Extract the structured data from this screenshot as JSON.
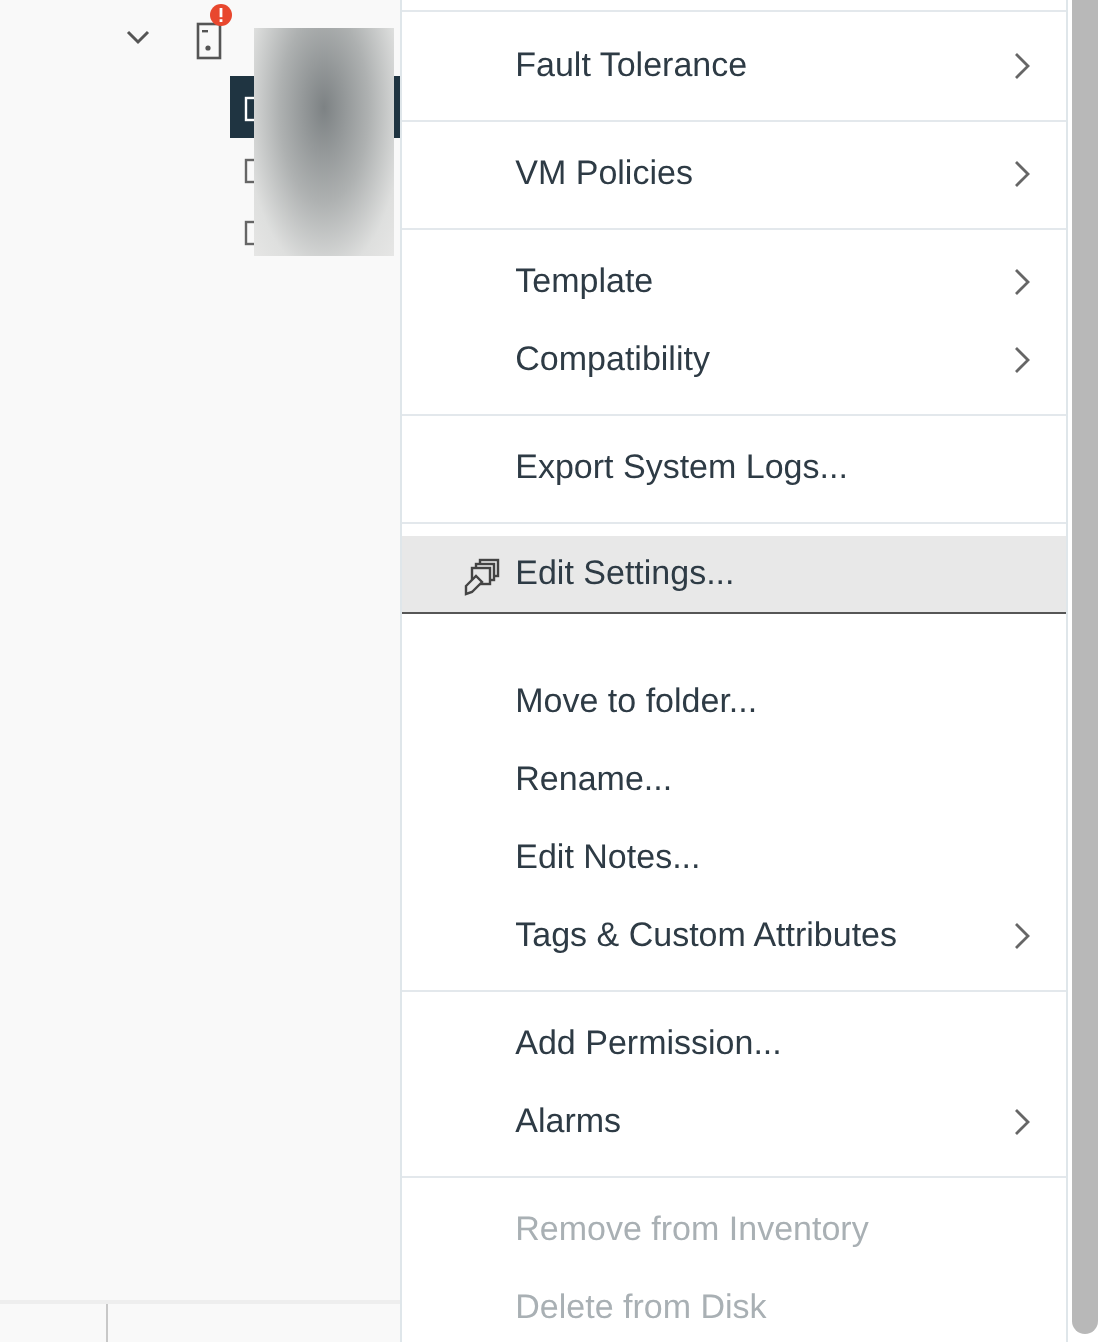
{
  "tree": {
    "host": {
      "expanded": true,
      "alert": true
    },
    "vms": [
      {
        "selected": true
      },
      {
        "selected": false
      },
      {
        "selected": false
      }
    ]
  },
  "menu": {
    "sections": [
      {
        "items": [
          {
            "kind": "text",
            "label": "Fault Tolerance",
            "submenu": true,
            "disabled": false,
            "selected": false
          }
        ]
      },
      {
        "items": [
          {
            "kind": "text",
            "label": "VM Policies",
            "submenu": true,
            "disabled": false,
            "selected": false
          }
        ]
      },
      {
        "items": [
          {
            "kind": "text",
            "label": "Template",
            "submenu": true,
            "disabled": false,
            "selected": false
          },
          {
            "kind": "text",
            "label": "Compatibility",
            "submenu": true,
            "disabled": false,
            "selected": false
          }
        ]
      },
      {
        "items": [
          {
            "kind": "text",
            "label": "Export System Logs...",
            "submenu": false,
            "disabled": false,
            "selected": false
          }
        ]
      },
      {
        "items": [
          {
            "kind": "icon",
            "label": "Edit Settings...",
            "submenu": false,
            "disabled": false,
            "selected": true
          }
        ]
      },
      {
        "items": [
          {
            "kind": "text",
            "label": "Move to folder...",
            "submenu": false,
            "disabled": false,
            "selected": false
          },
          {
            "kind": "text",
            "label": "Rename...",
            "submenu": false,
            "disabled": false,
            "selected": false
          },
          {
            "kind": "text",
            "label": "Edit Notes...",
            "submenu": false,
            "disabled": false,
            "selected": false
          },
          {
            "kind": "text",
            "label": "Tags & Custom Attributes",
            "submenu": true,
            "disabled": false,
            "selected": false
          }
        ]
      },
      {
        "items": [
          {
            "kind": "text",
            "label": "Add Permission...",
            "submenu": false,
            "disabled": false,
            "selected": false
          },
          {
            "kind": "text",
            "label": "Alarms",
            "submenu": true,
            "disabled": false,
            "selected": false
          }
        ]
      },
      {
        "items": [
          {
            "kind": "text",
            "label": "Remove from Inventory",
            "submenu": false,
            "disabled": true,
            "selected": false
          },
          {
            "kind": "text",
            "label": "Delete from Disk",
            "submenu": false,
            "disabled": true,
            "selected": false
          }
        ]
      }
    ]
  }
}
